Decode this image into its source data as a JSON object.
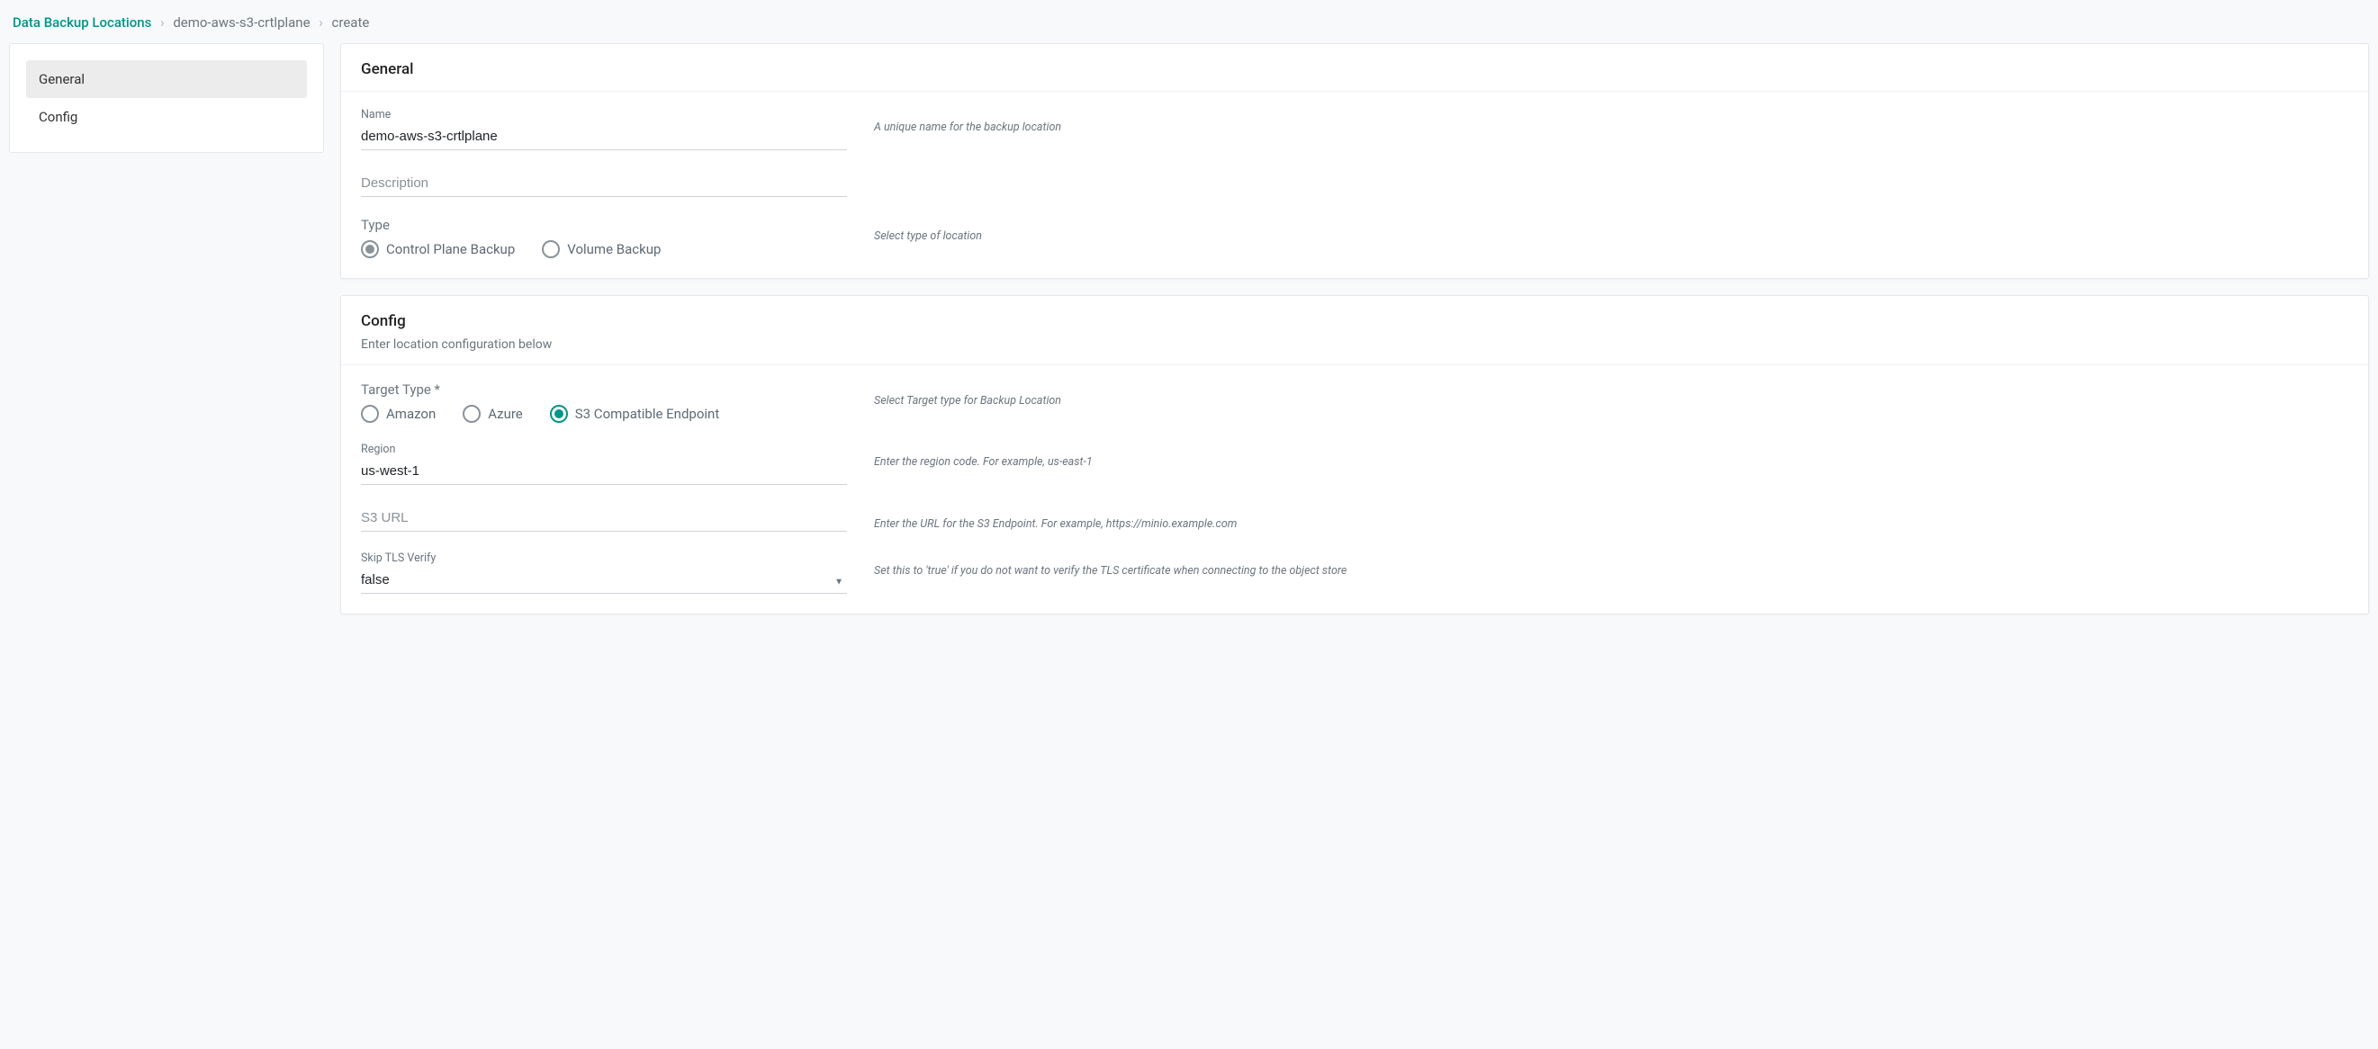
{
  "breadcrumb": {
    "root": "Data Backup Locations",
    "item": "demo-aws-s3-crtlplane",
    "leaf": "create",
    "sep": "›"
  },
  "sidebar": {
    "items": [
      {
        "label": "General",
        "active": true
      },
      {
        "label": "Config",
        "active": false
      }
    ]
  },
  "general": {
    "title": "General",
    "name_label": "Name",
    "name_value": "demo-aws-s3-crtlplane",
    "name_help": "A unique name for the backup location",
    "description_placeholder": "Description",
    "type_label": "Type",
    "type_help": "Select type of location",
    "type_options": {
      "control_plane": "Control Plane Backup",
      "volume": "Volume Backup"
    }
  },
  "config": {
    "title": "Config",
    "subtitle": "Enter location configuration below",
    "target_type_label": "Target Type *",
    "target_type_help": "Select Target type for Backup Location",
    "target_options": {
      "amazon": "Amazon",
      "azure": "Azure",
      "s3compat": "S3 Compatible Endpoint"
    },
    "region_label": "Region",
    "region_value": "us-west-1",
    "region_help": "Enter the region code. For example, us-east-1",
    "s3url_placeholder": "S3 URL",
    "s3url_help": "Enter the URL for the S3 Endpoint. For example, https://minio.example.com",
    "skip_tls_label": "Skip TLS Verify",
    "skip_tls_value": "false",
    "skip_tls_help": "Set this to 'true' if you do not want to verify the TLS certificate when connecting to the object store"
  }
}
